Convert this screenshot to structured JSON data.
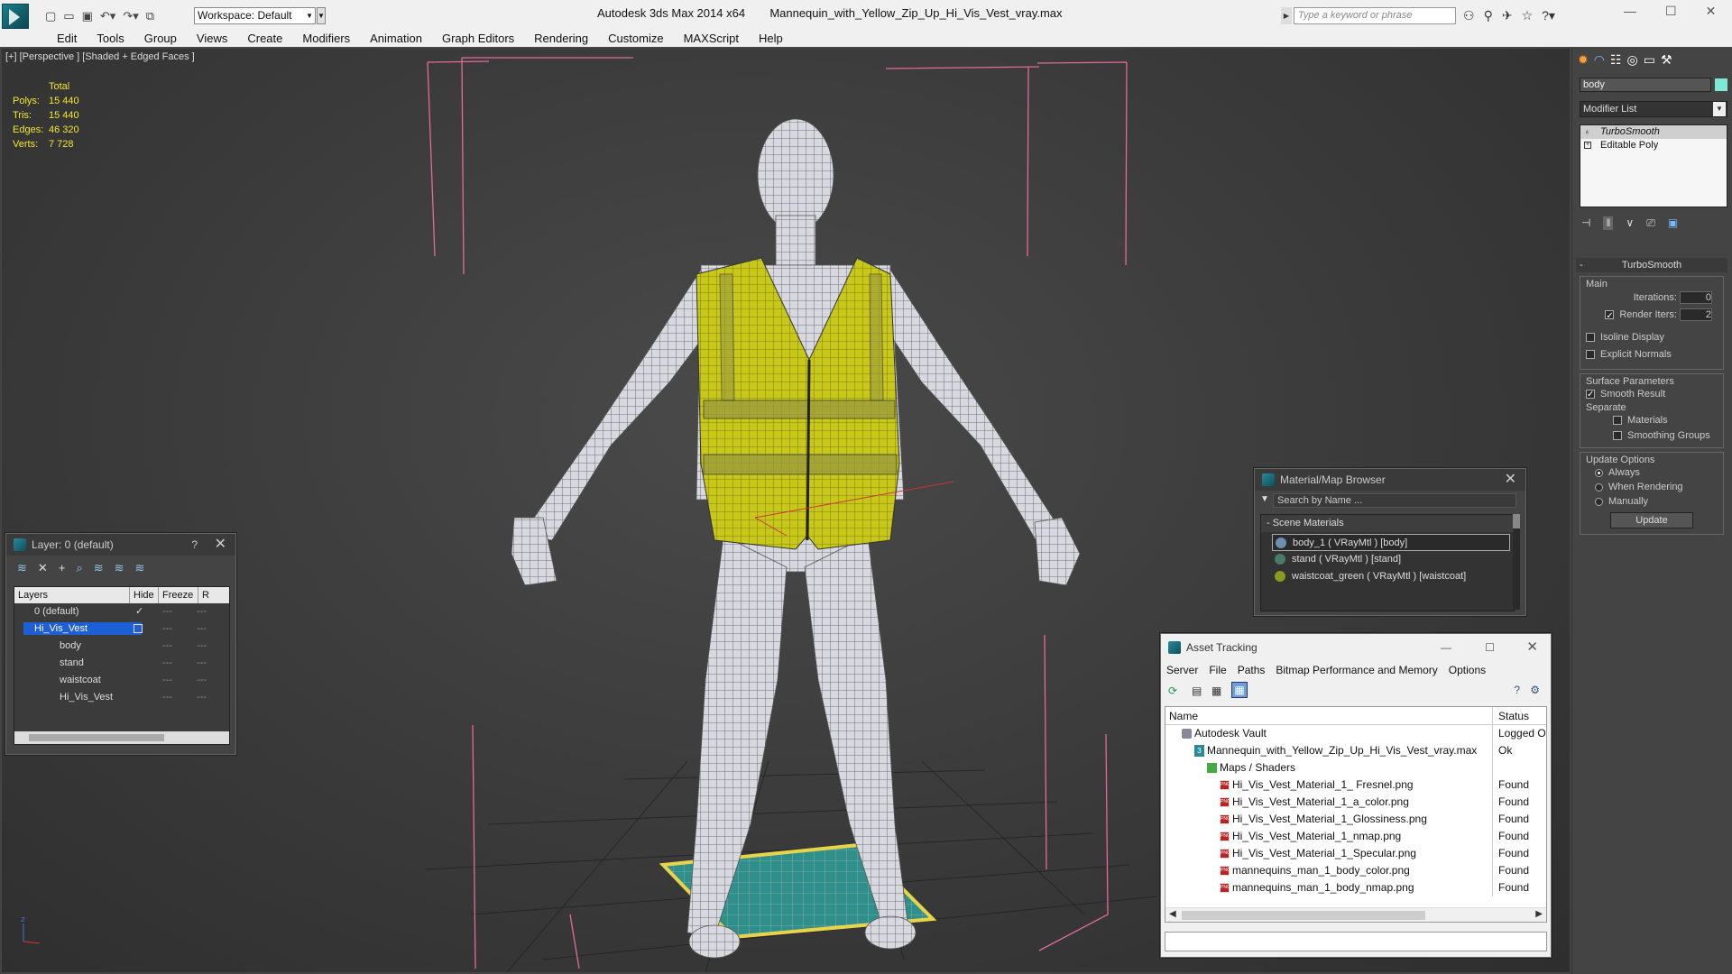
{
  "title_bar": {
    "app": "Autodesk 3ds Max  2014 x64",
    "file": "Mannequin_with_Yellow_Zip_Up_Hi_Vis_Vest_vray.max",
    "workspace": "Workspace: Default",
    "search_placeholder": "Type a keyword or phrase"
  },
  "menu": [
    "Edit",
    "Tools",
    "Group",
    "Views",
    "Create",
    "Modifiers",
    "Animation",
    "Graph Editors",
    "Rendering",
    "Customize",
    "MAXScript",
    "Help"
  ],
  "viewport": {
    "label": "[+] [Perspective ] [Shaded + Edged Faces ]",
    "stats_header": "Total",
    "stats": [
      {
        "label": "Polys:",
        "value": "15 440"
      },
      {
        "label": "Tris:",
        "value": "15 440"
      },
      {
        "label": "Edges:",
        "value": "46 320"
      },
      {
        "label": "Verts:",
        "value": "7 728"
      }
    ]
  },
  "layer_panel": {
    "title": "Layer: 0 (default)",
    "help": "?",
    "columns": [
      "Layers",
      "Hide",
      "Freeze",
      "R"
    ],
    "rows": [
      {
        "name": "0 (default)",
        "selected": false,
        "indent": 0
      },
      {
        "name": "Hi_Vis_Vest",
        "selected": true,
        "indent": 0
      },
      {
        "name": "body",
        "selected": false,
        "indent": 1
      },
      {
        "name": "stand",
        "selected": false,
        "indent": 1
      },
      {
        "name": "waistcoat",
        "selected": false,
        "indent": 1
      },
      {
        "name": "Hi_Vis_Vest",
        "selected": false,
        "indent": 1
      }
    ]
  },
  "material_browser": {
    "title": "Material/Map Browser",
    "search_placeholder": "Search by Name ...",
    "section": "- Scene Materials",
    "items": [
      "body_1  ( VRayMtl ) [body]",
      "stand  ( VRayMtl ) [stand]",
      "waistcoat_green  ( VRayMtl ) [waistcoat]"
    ]
  },
  "asset_tracking": {
    "title": "Asset Tracking",
    "menu": [
      "Server",
      "File",
      "Paths",
      "Bitmap Performance and Memory",
      "Options"
    ],
    "columns": [
      "Name",
      "Status"
    ],
    "rows": [
      {
        "name": "Autodesk Vault",
        "status": "Logged Ou",
        "indent": 1,
        "icon": "vault"
      },
      {
        "name": "Mannequin_with_Yellow_Zip_Up_Hi_Vis_Vest_vray.max",
        "status": "Ok",
        "indent": 2,
        "icon": "max"
      },
      {
        "name": "Maps / Shaders",
        "status": "",
        "indent": 3,
        "icon": "maps"
      },
      {
        "name": "Hi_Vis_Vest_Material_1_ Fresnel.png",
        "status": "Found",
        "indent": 4,
        "icon": "png"
      },
      {
        "name": "Hi_Vis_Vest_Material_1_a_color.png",
        "status": "Found",
        "indent": 4,
        "icon": "png"
      },
      {
        "name": "Hi_Vis_Vest_Material_1_Glossiness.png",
        "status": "Found",
        "indent": 4,
        "icon": "png"
      },
      {
        "name": "Hi_Vis_Vest_Material_1_nmap.png",
        "status": "Found",
        "indent": 4,
        "icon": "png"
      },
      {
        "name": "Hi_Vis_Vest_Material_1_Specular.png",
        "status": "Found",
        "indent": 4,
        "icon": "png"
      },
      {
        "name": "mannequins_man_1_body_color.png",
        "status": "Found",
        "indent": 4,
        "icon": "png"
      },
      {
        "name": "mannequins_man_1_body_nmap.png",
        "status": "Found",
        "indent": 4,
        "icon": "png"
      }
    ]
  },
  "command_panel": {
    "object_name": "body",
    "modifier_list": "Modifier List",
    "stack": [
      "TurboSmooth",
      "Editable Poly"
    ],
    "rollout_title": "TurboSmooth",
    "main_label": "Main",
    "iterations_label": "Iterations:",
    "iterations_value": "0",
    "render_iters_label": "Render Iters:",
    "render_iters_value": "2",
    "isoline": "Isoline Display",
    "explicit_normals": "Explicit Normals",
    "surface_params": "Surface Parameters",
    "smooth_result": "Smooth Result",
    "separate": "Separate",
    "materials": "Materials",
    "smoothing_groups": "Smoothing Groups",
    "update_options": "Update Options",
    "always": "Always",
    "when_rendering": "When Rendering",
    "manually": "Manually",
    "update_button": "Update"
  },
  "colors": {
    "vest": "#c8c81a",
    "selection": "#1e5fd6",
    "stand": "#2f8f8a",
    "accent": "#0d5f6e"
  }
}
